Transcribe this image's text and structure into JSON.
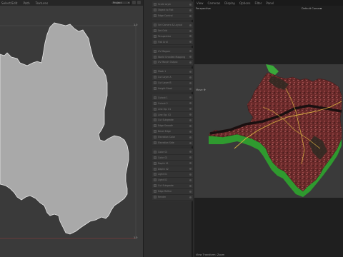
{
  "uv_editor": {
    "menu": [
      "Select/Edit",
      "Path",
      "Textures"
    ],
    "dropdown_value": "Project",
    "axis": {
      "top_right": "1.0",
      "bottom_right": "1.0"
    },
    "shape_fill": "#a9a9a9",
    "shape_stroke": "#e6e6e6",
    "baseline_color": "#7a3a3a"
  },
  "layers": {
    "groups": [
      [
        "Scale Layer",
        "Object to Flat",
        "Edge Control"
      ],
      [
        "Set Camera & Layout",
        "Set Grid",
        "Perspective",
        "Flat Grid"
      ],
      [
        "UV Mapper",
        "World Unrolled Mapping",
        "UV Morph Output"
      ],
      [
        "Mask 1",
        "Cut Layer A",
        "Cut Layer B",
        "Height Stack"
      ],
      [
        "Cutout 1",
        "Cutout 2",
        "Line Op: 01",
        "Line Op: 02",
        "Cut Subgrade",
        "Edge Smooth",
        "Bevel Edge",
        "Elevation Color",
        "Elevation Side"
      ],
      [
        "Color 01",
        "Color 02",
        "Depth 01",
        "Depth 02",
        "Light 01",
        "Light 02",
        "Cut Subgrade",
        "Edge Refine",
        "Render"
      ]
    ]
  },
  "viewport": {
    "menu": [
      "View",
      "Cameras",
      "Display",
      "Options",
      "Filter",
      "Panel"
    ],
    "view_name": "Perspective",
    "camera_name": "Default Camera",
    "move_label": "Move ✥",
    "status": "View Transform: Zoom",
    "colors": {
      "terrain_top": "#6b2a2a",
      "wall_green": "#2f9a2f",
      "road_yellow": "#d8b040"
    }
  }
}
